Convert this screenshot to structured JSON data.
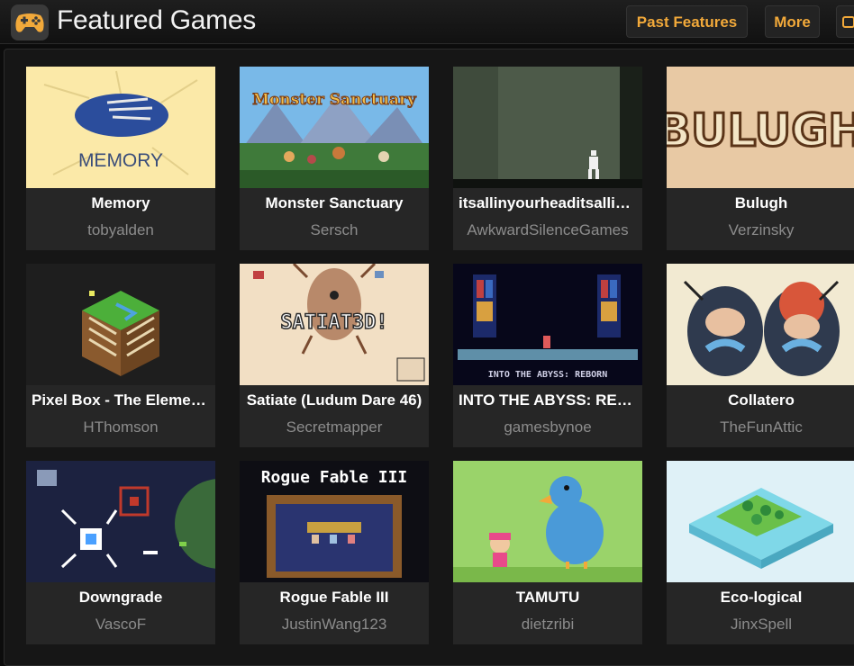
{
  "header": {
    "title": "Featured Games",
    "past_features_label": "Past Features",
    "more_label": "More",
    "logo_icon": "gamepad-icon",
    "accent": "#f2a93a"
  },
  "games": [
    {
      "name": "Memory",
      "author": "tobyalden",
      "thumb_text": "MEMORY"
    },
    {
      "name": "Monster Sanctuary",
      "author": "Sersch",
      "thumb_text": "Monster Sanctuary"
    },
    {
      "name": "itsallinyourheaditsallinyourhead",
      "author": "AwkwardSilenceGames",
      "thumb_text": ""
    },
    {
      "name": "Bulugh",
      "author": "Verzinsky",
      "thumb_text": "BULUGH"
    },
    {
      "name": "Pixel Box - The Elements",
      "author": "HThomson",
      "thumb_text": ""
    },
    {
      "name": "Satiate (Ludum Dare 46)",
      "author": "Secretmapper",
      "thumb_text": "SATIAT3D!"
    },
    {
      "name": "INTO THE ABYSS: REBORN",
      "author": "gamesbynoe",
      "thumb_text": "INTO THE ABYSS: REBORN"
    },
    {
      "name": "Collatero",
      "author": "TheFunAttic",
      "thumb_text": ""
    },
    {
      "name": "Downgrade",
      "author": "VascoF",
      "thumb_text": ""
    },
    {
      "name": "Rogue Fable III",
      "author": "JustinWang123",
      "thumb_text": "Rogue Fable III"
    },
    {
      "name": "TAMUTU",
      "author": "dietzribi",
      "thumb_text": ""
    },
    {
      "name": "Eco-logical",
      "author": "JinxSpell",
      "thumb_text": ""
    }
  ]
}
